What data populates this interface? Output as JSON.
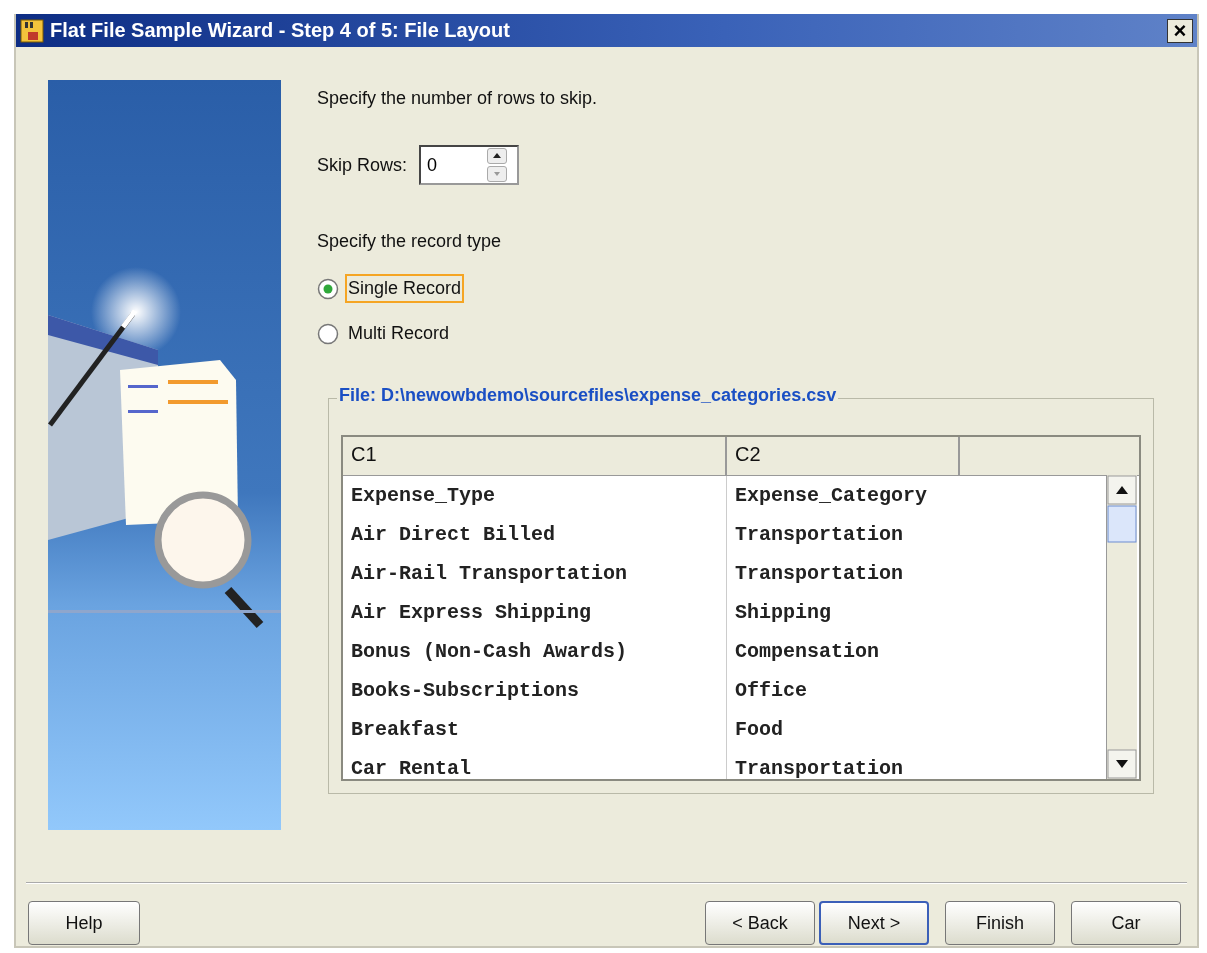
{
  "window": {
    "title": "Flat File Sample Wizard - Step 4 of 5: File Layout",
    "close": "×"
  },
  "skip_prompt": "Specify the number of rows to skip.",
  "skip_rows": {
    "label": "Skip Rows:",
    "value": "0"
  },
  "record_prompt": "Specify the record type",
  "record_types": [
    {
      "label": "Single Record",
      "selected": true,
      "focused": true
    },
    {
      "label": "Multi Record",
      "selected": false,
      "focused": false
    }
  ],
  "file_group": {
    "title": "File: D:\\newowbdemo\\sourcefiles\\expense_categories.csv",
    "table": {
      "columns": [
        "C1",
        "C2"
      ],
      "rows": [
        [
          "Expense_Type",
          "Expense_Category"
        ],
        [
          "Air Direct Billed",
          "Transportation"
        ],
        [
          "Air-Rail Transportation",
          "Transportation"
        ],
        [
          "Air Express Shipping",
          "Shipping"
        ],
        [
          "Bonus (Non-Cash Awards)",
          "Compensation"
        ],
        [
          "Books-Subscriptions",
          "Office"
        ],
        [
          "Breakfast",
          "Food"
        ],
        [
          "Car Rental",
          "Transportation"
        ]
      ]
    }
  },
  "buttons": [
    {
      "label": "Help",
      "default": false
    },
    {
      "label": "< Back",
      "default": false
    },
    {
      "label": "Next >",
      "default": true
    },
    {
      "label": "Finish",
      "default": false
    },
    {
      "label": "Car",
      "default": false
    }
  ]
}
